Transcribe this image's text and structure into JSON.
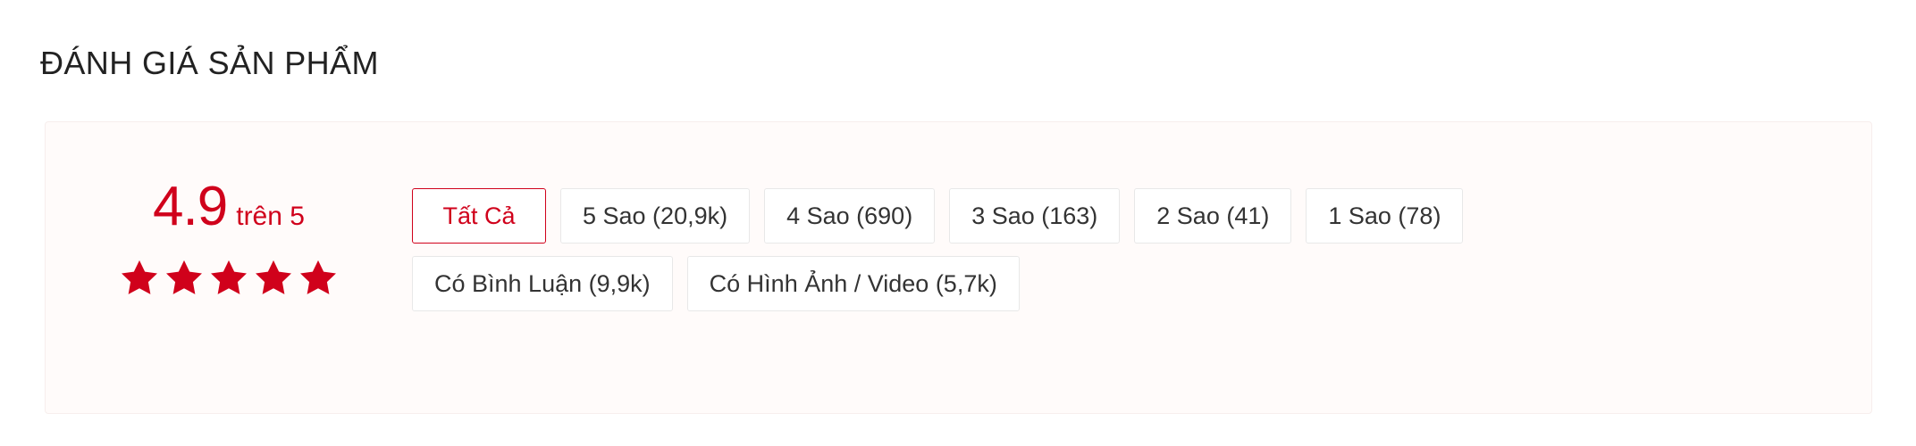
{
  "section": {
    "title": "ĐÁNH GIÁ SẢN PHẨM"
  },
  "rating": {
    "score": "4.9",
    "out_of_label": "trên 5",
    "stars_filled": 5,
    "stars_total": 5,
    "star_icon": "star-icon"
  },
  "filters": {
    "rows": [
      [
        {
          "label": "Tất Cả",
          "active": true
        },
        {
          "label": "5 Sao (20,9k)",
          "active": false
        },
        {
          "label": "4 Sao (690)",
          "active": false
        },
        {
          "label": "3 Sao (163)",
          "active": false
        },
        {
          "label": "2 Sao (41)",
          "active": false
        },
        {
          "label": "1 Sao (78)",
          "active": false
        }
      ],
      [
        {
          "label": "Có Bình Luận (9,9k)",
          "active": false
        },
        {
          "label": "Có Hình Ảnh / Video (5,7k)",
          "active": false
        }
      ]
    ]
  },
  "colors": {
    "accent": "#d0011b",
    "star": "#d0011b",
    "panel_background": "#fffbfa",
    "panel_border": "#f7eeed",
    "chip_border": "#e8e8e8",
    "chip_background": "#ffffff",
    "title_text": "#222222",
    "chip_text": "#333333",
    "page_background": "#ffffff"
  }
}
